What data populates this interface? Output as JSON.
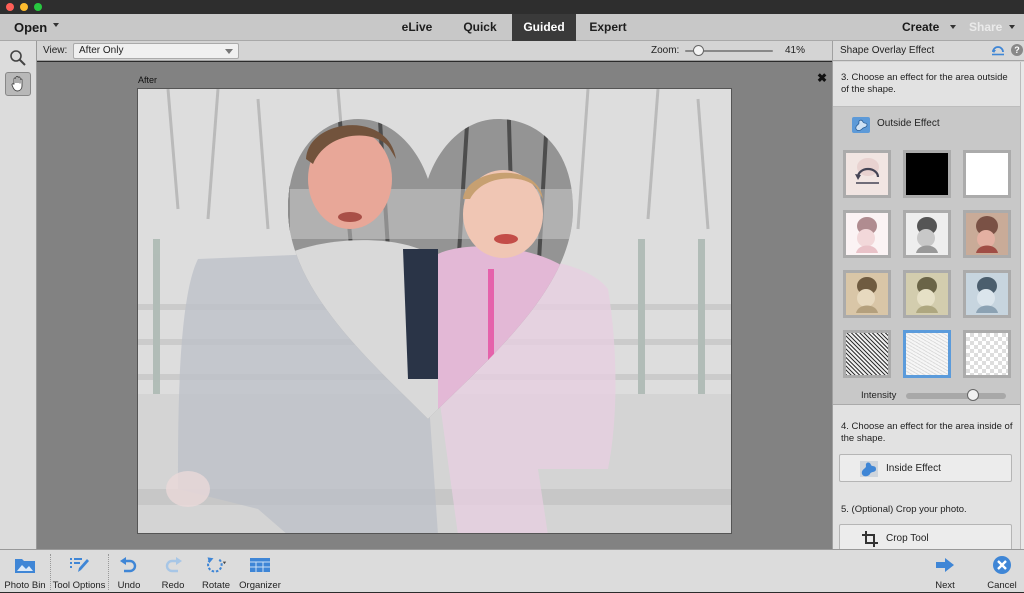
{
  "window": {
    "traffic_lights": {
      "close": "#ff5f57",
      "minimize": "#febc2e",
      "zoom": "#28c840"
    }
  },
  "menubar": {
    "open_label": "Open",
    "modes": [
      {
        "label": "eLive",
        "active": false
      },
      {
        "label": "Quick",
        "active": false
      },
      {
        "label": "Guided",
        "active": true
      },
      {
        "label": "Expert",
        "active": false
      }
    ],
    "create_label": "Create",
    "share_label": "Share"
  },
  "tools": [
    {
      "name": "zoom-tool",
      "icon": "magnifier-icon",
      "active": false
    },
    {
      "name": "hand-tool",
      "icon": "hand-icon",
      "active": true
    }
  ],
  "options_bar": {
    "view_label": "View:",
    "view_value": "After Only",
    "zoom_label": "Zoom:",
    "zoom_value": "41%",
    "zoom_percent": 41
  },
  "canvas": {
    "image_label": "After",
    "close_symbol": "✖",
    "photo_description": "Two children sitting on a bench; heart-shaped overlay reveals color inside, faded noise effect outside"
  },
  "panel": {
    "title": "Shape Overlay Effect",
    "help_symbol": "?",
    "step3_text": "3. Choose an effect for the area outside of the shape.",
    "outside_effect_label": "Outside Effect",
    "thumbnails": [
      {
        "name": "reset-effect",
        "selected": false
      },
      {
        "name": "black-fill",
        "selected": false
      },
      {
        "name": "white-fill",
        "selected": false
      },
      {
        "name": "high-key",
        "selected": false
      },
      {
        "name": "black-and-white",
        "selected": false
      },
      {
        "name": "texture-color",
        "selected": false
      },
      {
        "name": "sepia-vignette",
        "selected": false
      },
      {
        "name": "antique-vignette",
        "selected": false
      },
      {
        "name": "cyanotype-vignette",
        "selected": false
      },
      {
        "name": "dark-noise",
        "selected": false
      },
      {
        "name": "light-noise",
        "selected": true
      },
      {
        "name": "transparent",
        "selected": false
      }
    ],
    "intensity_label": "Intensity",
    "intensity_percent": 76,
    "step4_text": "4. Choose an effect for the area inside of the shape.",
    "inside_effect_label": "Inside Effect",
    "step5_text": "5. (Optional) Crop your photo.",
    "crop_tool_label": "Crop Tool"
  },
  "bottombar": {
    "left": [
      {
        "label": "Photo Bin",
        "icon": "photo-bin-icon"
      },
      {
        "label": "Tool Options",
        "icon": "tool-options-icon"
      },
      {
        "label": "Undo",
        "icon": "undo-icon"
      },
      {
        "label": "Redo",
        "icon": "redo-icon"
      },
      {
        "label": "Rotate",
        "icon": "rotate-icon"
      },
      {
        "label": "Organizer",
        "icon": "organizer-icon"
      }
    ],
    "right": [
      {
        "label": "Next",
        "icon": "next-arrow-icon"
      },
      {
        "label": "Cancel",
        "icon": "cancel-icon"
      }
    ]
  },
  "colors": {
    "accent_blue": "#3f86d6",
    "selected_border": "#5b9bdb",
    "active_tab_bg": "#3a3a3a"
  }
}
